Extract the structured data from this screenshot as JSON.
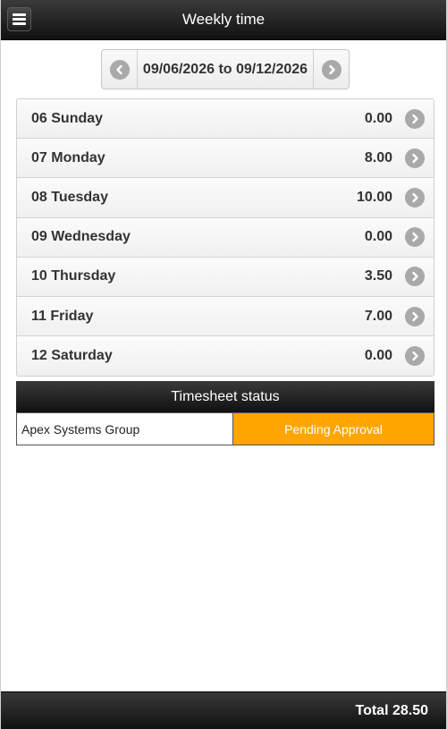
{
  "header": {
    "title": "Weekly time",
    "menu_icon": "hamburger-menu-icon"
  },
  "week_nav": {
    "range": "09/06/2026 to 09/12/2026",
    "prev_icon": "chevron-left-icon",
    "next_icon": "chevron-right-icon"
  },
  "days": [
    {
      "label": "06 Sunday",
      "hours": "0.00"
    },
    {
      "label": "07 Monday",
      "hours": "8.00"
    },
    {
      "label": "08 Tuesday",
      "hours": "10.00"
    },
    {
      "label": "09 Wednesday",
      "hours": "0.00"
    },
    {
      "label": "10 Thursday",
      "hours": "3.50"
    },
    {
      "label": "11 Friday",
      "hours": "7.00"
    },
    {
      "label": "12 Saturday",
      "hours": "0.00"
    }
  ],
  "status": {
    "title": "Timesheet status",
    "company": "Apex Systems Group",
    "state": "Pending Approval",
    "state_color": "#ffa500"
  },
  "footer": {
    "total": "Total 28.50"
  }
}
